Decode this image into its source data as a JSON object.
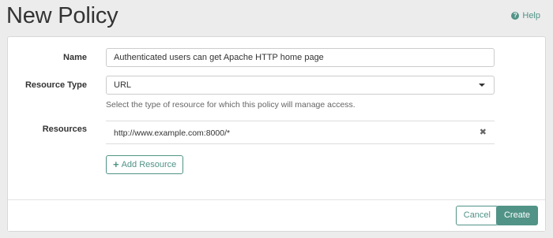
{
  "header": {
    "title": "New Policy",
    "help_label": "Help",
    "help_icon": "question-circle-icon"
  },
  "form": {
    "name_label": "Name",
    "name_value": "Authenticated users can get Apache HTTP home page",
    "resource_type_label": "Resource Type",
    "resource_type_value": "URL",
    "resource_type_help": "Select the type of resource for which this policy will manage access.",
    "resources_label": "Resources",
    "resources": [
      {
        "value": "http://www.example.com:8000/*"
      }
    ],
    "add_resource_label": "Add Resource"
  },
  "footer": {
    "cancel_label": "Cancel",
    "create_label": "Create"
  },
  "colors": {
    "accent": "#519387",
    "background": "#ececec",
    "panel": "#ffffff"
  }
}
